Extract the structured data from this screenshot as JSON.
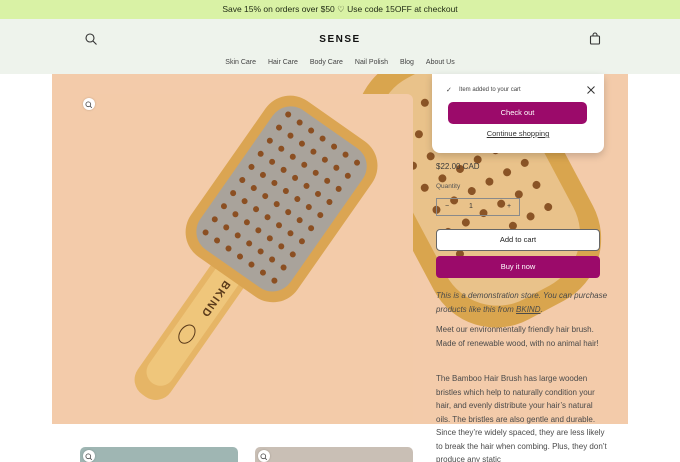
{
  "announcement": {
    "text": "Save 15% on orders over $50 ♡ Use code 15OFF at checkout"
  },
  "header": {
    "logo": "SENSE",
    "search_icon": "search-icon",
    "cart_icon": "bag-icon"
  },
  "nav": {
    "items": [
      {
        "label": "Skin Care"
      },
      {
        "label": "Hair Care"
      },
      {
        "label": "Body Care"
      },
      {
        "label": "Nail Polish"
      },
      {
        "label": "Blog"
      },
      {
        "label": "About Us"
      }
    ]
  },
  "product": {
    "image_text": "BKIND",
    "price": "$22.00 CAD",
    "quantity_label": "Quantity",
    "quantity_value": "1",
    "quantity_minus": "−",
    "quantity_plus": "+",
    "add_to_cart": "Add to cart",
    "buy_now": "Buy it now",
    "demo_text_prefix": "This is a demonstration store. You can purchase products like this from ",
    "demo_link": "BKIND",
    "demo_text_suffix": ".",
    "desc_1": "Meet our environmentally friendly hair brush. Made of renewable wood, with no animal hair!",
    "desc_2": "The Bamboo Hair Brush has large wooden bristles which help to naturally condition your hair, and evenly distribute your hair’s natural oils. The bristles are also gentle and durable. Since they’re widely spaced, they are less likely to break the hair when combing. Plus, they don’t produce any static"
  },
  "popup": {
    "message": "Item added to your cart",
    "checkout": "Check out",
    "continue": "Continue shopping",
    "check_icon": "check-icon",
    "close_icon": "close-icon"
  },
  "colors": {
    "announcement_bg": "#d9f2a5",
    "header_bg": "#eef3ec",
    "product_bg": "#f3cbaa",
    "accent": "#9b0a6a",
    "wood": "#d9a54e"
  }
}
